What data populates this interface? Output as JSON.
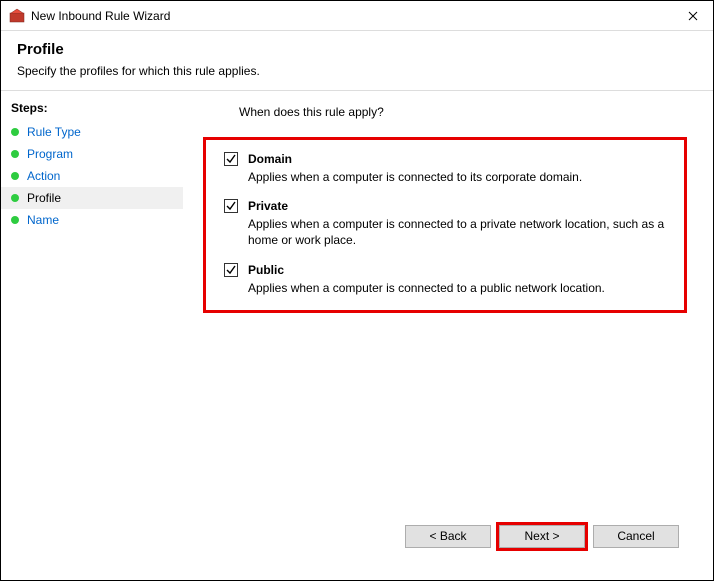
{
  "window": {
    "title": "New Inbound Rule Wizard"
  },
  "header": {
    "title": "Profile",
    "subtitle": "Specify the profiles for which this rule applies."
  },
  "sidebar": {
    "heading": "Steps:",
    "items": [
      {
        "label": "Rule Type"
      },
      {
        "label": "Program"
      },
      {
        "label": "Action"
      },
      {
        "label": "Profile"
      },
      {
        "label": "Name"
      }
    ]
  },
  "content": {
    "question": "When does this rule apply?",
    "options": [
      {
        "label": "Domain",
        "desc": "Applies when a computer is connected to its corporate domain."
      },
      {
        "label": "Private",
        "desc": "Applies when a computer is connected to a private network location, such as a home or work place."
      },
      {
        "label": "Public",
        "desc": "Applies when a computer is connected to a public network location."
      }
    ]
  },
  "footer": {
    "back": "< Back",
    "next": "Next >",
    "cancel": "Cancel"
  }
}
